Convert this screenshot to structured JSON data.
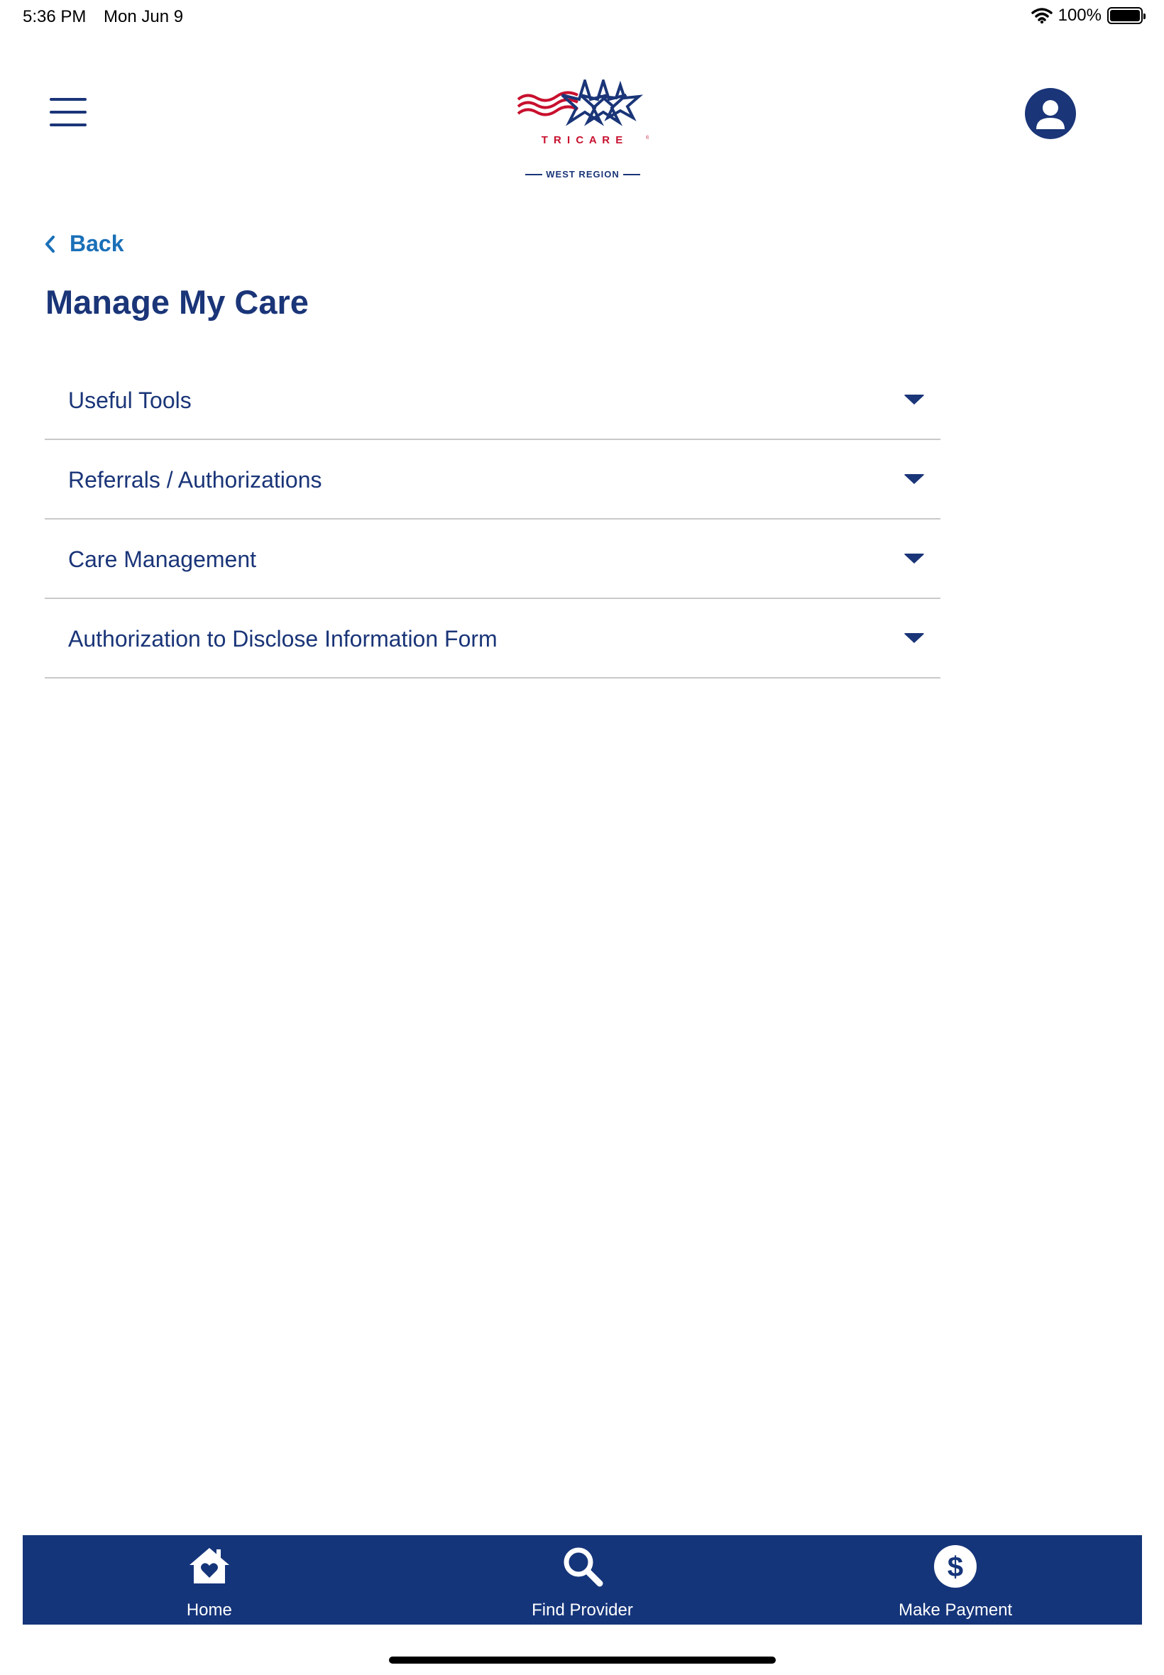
{
  "status_bar": {
    "time": "5:36 PM",
    "date": "Mon Jun 9",
    "battery_pct": "100%",
    "battery_level": 1.0
  },
  "header": {
    "menu_icon": "hamburger-menu-icon",
    "logo": {
      "wordmark": "T R I C A R E",
      "registered": "®",
      "region": "WEST REGION"
    },
    "account_icon": "user-account-icon"
  },
  "nav": {
    "back_label": "Back",
    "back_icon": "chevron-left-icon"
  },
  "page": {
    "title": "Manage My Care"
  },
  "accordion": {
    "items": [
      {
        "label": "Useful Tools",
        "icon": "caret-down-icon"
      },
      {
        "label": "Referrals / Authorizations",
        "icon": "caret-down-icon"
      },
      {
        "label": "Care Management",
        "icon": "caret-down-icon"
      },
      {
        "label": "Authorization to Disclose Information Form",
        "icon": "caret-down-icon"
      }
    ]
  },
  "tab_bar": {
    "tabs": [
      {
        "label": "Home",
        "icon": "home-heart-icon"
      },
      {
        "label": "Find Provider",
        "icon": "search-icon"
      },
      {
        "label": "Make Payment",
        "icon": "dollar-circle-icon"
      }
    ]
  },
  "colors": {
    "primary_navy": "#1a3578",
    "link_blue": "#1a70b8",
    "tab_bar_bg": "#15357a",
    "logo_red": "#c8102e",
    "divider": "#c9c9c9"
  }
}
